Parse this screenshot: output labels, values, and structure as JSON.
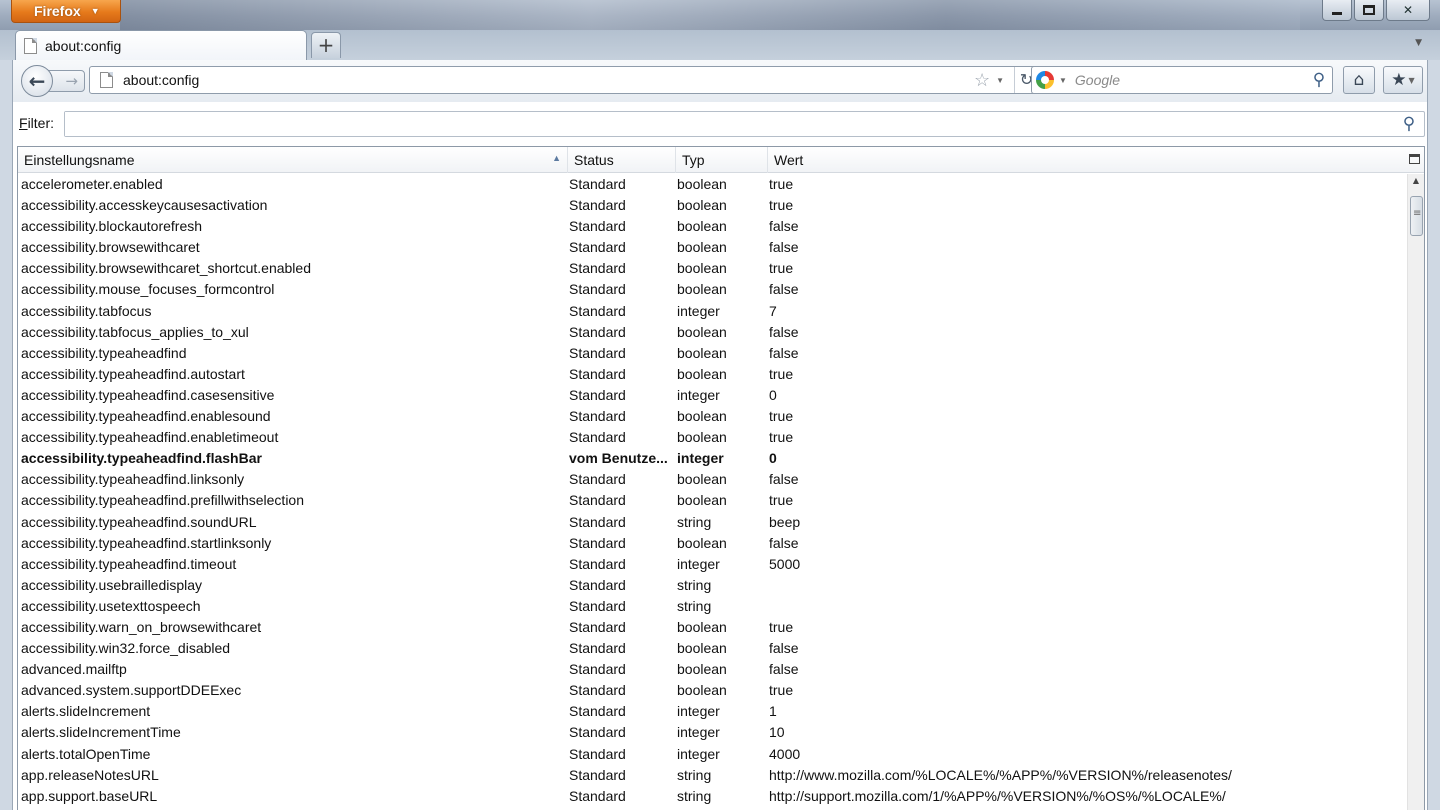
{
  "window": {
    "app_button_label": "Firefox",
    "controls": [
      "minimize",
      "maximize",
      "close"
    ]
  },
  "tab": {
    "title": "about:config"
  },
  "navbar": {
    "url": "about:config",
    "search_placeholder": "Google"
  },
  "filter": {
    "label_prefix": "F",
    "label_rest": "ilter:",
    "value": ""
  },
  "columns": {
    "name": "Einstellungsname",
    "status": "Status",
    "type": "Typ",
    "value": "Wert"
  },
  "prefs": [
    {
      "name": "accelerometer.enabled",
      "status": "Standard",
      "type": "boolean",
      "value": "true"
    },
    {
      "name": "accessibility.accesskeycausesactivation",
      "status": "Standard",
      "type": "boolean",
      "value": "true"
    },
    {
      "name": "accessibility.blockautorefresh",
      "status": "Standard",
      "type": "boolean",
      "value": "false"
    },
    {
      "name": "accessibility.browsewithcaret",
      "status": "Standard",
      "type": "boolean",
      "value": "false"
    },
    {
      "name": "accessibility.browsewithcaret_shortcut.enabled",
      "status": "Standard",
      "type": "boolean",
      "value": "true"
    },
    {
      "name": "accessibility.mouse_focuses_formcontrol",
      "status": "Standard",
      "type": "boolean",
      "value": "false"
    },
    {
      "name": "accessibility.tabfocus",
      "status": "Standard",
      "type": "integer",
      "value": "7"
    },
    {
      "name": "accessibility.tabfocus_applies_to_xul",
      "status": "Standard",
      "type": "boolean",
      "value": "false"
    },
    {
      "name": "accessibility.typeaheadfind",
      "status": "Standard",
      "type": "boolean",
      "value": "false"
    },
    {
      "name": "accessibility.typeaheadfind.autostart",
      "status": "Standard",
      "type": "boolean",
      "value": "true"
    },
    {
      "name": "accessibility.typeaheadfind.casesensitive",
      "status": "Standard",
      "type": "integer",
      "value": "0"
    },
    {
      "name": "accessibility.typeaheadfind.enablesound",
      "status": "Standard",
      "type": "boolean",
      "value": "true"
    },
    {
      "name": "accessibility.typeaheadfind.enabletimeout",
      "status": "Standard",
      "type": "boolean",
      "value": "true"
    },
    {
      "name": "accessibility.typeaheadfind.flashBar",
      "status": "vom Benutze...",
      "type": "integer",
      "value": "0",
      "modified": true
    },
    {
      "name": "accessibility.typeaheadfind.linksonly",
      "status": "Standard",
      "type": "boolean",
      "value": "false"
    },
    {
      "name": "accessibility.typeaheadfind.prefillwithselection",
      "status": "Standard",
      "type": "boolean",
      "value": "true"
    },
    {
      "name": "accessibility.typeaheadfind.soundURL",
      "status": "Standard",
      "type": "string",
      "value": "beep"
    },
    {
      "name": "accessibility.typeaheadfind.startlinksonly",
      "status": "Standard",
      "type": "boolean",
      "value": "false"
    },
    {
      "name": "accessibility.typeaheadfind.timeout",
      "status": "Standard",
      "type": "integer",
      "value": "5000"
    },
    {
      "name": "accessibility.usebrailledisplay",
      "status": "Standard",
      "type": "string",
      "value": ""
    },
    {
      "name": "accessibility.usetexttospeech",
      "status": "Standard",
      "type": "string",
      "value": ""
    },
    {
      "name": "accessibility.warn_on_browsewithcaret",
      "status": "Standard",
      "type": "boolean",
      "value": "true"
    },
    {
      "name": "accessibility.win32.force_disabled",
      "status": "Standard",
      "type": "boolean",
      "value": "false"
    },
    {
      "name": "advanced.mailftp",
      "status": "Standard",
      "type": "boolean",
      "value": "false"
    },
    {
      "name": "advanced.system.supportDDEExec",
      "status": "Standard",
      "type": "boolean",
      "value": "true"
    },
    {
      "name": "alerts.slideIncrement",
      "status": "Standard",
      "type": "integer",
      "value": "1"
    },
    {
      "name": "alerts.slideIncrementTime",
      "status": "Standard",
      "type": "integer",
      "value": "10"
    },
    {
      "name": "alerts.totalOpenTime",
      "status": "Standard",
      "type": "integer",
      "value": "4000"
    },
    {
      "name": "app.releaseNotesURL",
      "status": "Standard",
      "type": "string",
      "value": "http://www.mozilla.com/%LOCALE%/%APP%/%VERSION%/releasenotes/"
    },
    {
      "name": "app.support.baseURL",
      "status": "Standard",
      "type": "string",
      "value": "http://support.mozilla.com/1/%APP%/%VERSION%/%OS%/%LOCALE%/"
    }
  ]
}
